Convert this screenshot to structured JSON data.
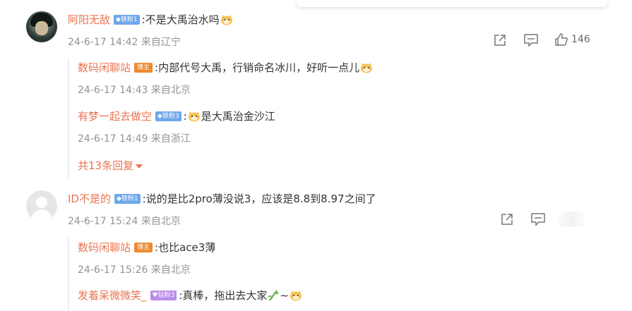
{
  "comments": [
    {
      "user": "阿阳无敌",
      "badge": "铁粉1",
      "text": ":不是大禹治水吗",
      "time": "24-6-17 14:42 来自辽宁",
      "likes": "146",
      "replies": [
        {
          "user": "数码闲聊站",
          "badge": "博主",
          "text": ":内部代号大禹，行销命名冰川，好听一点儿",
          "time": "24-6-17 14:43 来自北京"
        },
        {
          "user": "有梦一起去做空",
          "badge": "铁粉3",
          "text": "是大禹治金沙江",
          "text_prefix": ":",
          "time": "24-6-17 14:49 来自浙江"
        }
      ],
      "more_replies": "共13条回复"
    },
    {
      "user": "ID不是的",
      "badge": "铁粉1",
      "text": ":说的是比2pro薄没说3，应该是8.8到8.97之间了",
      "time": "24-6-17 15:24 来自北京",
      "replies": [
        {
          "user": "数码闲聊站",
          "badge": "博主",
          "text": ":也比ace3薄",
          "time": "24-6-17 15:26 来自北京"
        },
        {
          "user": "发着呆微微笑_",
          "badge": "钻粉3",
          "text": ":真棒，拖出去大家",
          "text_suffix": "~",
          "time": ""
        }
      ]
    }
  ],
  "colors": {
    "username": "#eb7350",
    "meta": "#939393",
    "badge_blue": "#6ea7ec",
    "badge_purple": "#b98de8",
    "badge_host": "#f08a30"
  },
  "icons": [
    "share-icon",
    "comment-icon",
    "like-icon",
    "doge-emoji",
    "bamboo-emoji"
  ]
}
